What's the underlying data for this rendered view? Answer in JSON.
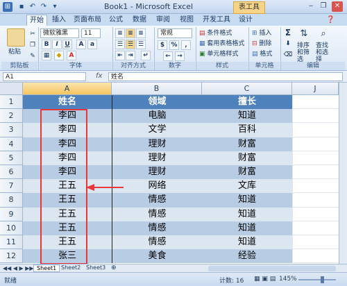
{
  "window": {
    "title": "Book1 - Microsoft Excel",
    "context_tab": "表工具",
    "controls": [
      "‒",
      "❐",
      "✕"
    ]
  },
  "tabs": [
    "开始",
    "插入",
    "页面布局",
    "公式",
    "数据",
    "审阅",
    "视图",
    "开发工具",
    "设计"
  ],
  "ribbon": {
    "paste": "粘贴",
    "font_name": "微软雅黑",
    "font_size": "11",
    "number_format": "常规",
    "conditional_format": "条件格式",
    "table_format": "套用表格格式",
    "cell_style": "单元格样式",
    "insert": "插入",
    "delete": "删除",
    "format": "格式",
    "sort_filter": "排序和筛选",
    "find_select": "查找和选择",
    "groups": [
      "剪贴板",
      "字体",
      "对齐方式",
      "数字",
      "样式",
      "单元格",
      "编辑"
    ]
  },
  "formula_bar": {
    "name_box": "A1",
    "fx": "fx",
    "content": "姓名"
  },
  "columns": [
    "A",
    "B",
    "C",
    "J"
  ],
  "rows": [
    "1",
    "2",
    "3",
    "4",
    "5",
    "6",
    "7",
    "8",
    "9",
    "10",
    "11",
    "12"
  ],
  "table": {
    "headers": [
      "姓名",
      "领域",
      "擅长"
    ],
    "data": [
      [
        "李四",
        "电脑",
        "知道"
      ],
      [
        "李四",
        "文学",
        "百科"
      ],
      [
        "李四",
        "理财",
        "财富"
      ],
      [
        "李四",
        "理财",
        "财富"
      ],
      [
        "李四",
        "理财",
        "财富"
      ],
      [
        "王五",
        "网络",
        "文库"
      ],
      [
        "王五",
        "情感",
        "知道"
      ],
      [
        "王五",
        "情感",
        "知道"
      ],
      [
        "王五",
        "情感",
        "知道"
      ],
      [
        "王五",
        "情感",
        "知道"
      ],
      [
        "张三",
        "美食",
        "经验"
      ]
    ]
  },
  "sheets": [
    "Sheet1",
    "Sheet2",
    "Sheet3"
  ],
  "status": {
    "mode": "就绪",
    "count": "计数: 16",
    "zoom": "145%"
  },
  "colors": {
    "header_fill": "#4f81bd",
    "band_dark": "#b8cce4",
    "band_light": "#dce6f1",
    "annotation_red": "#e8373a"
  }
}
